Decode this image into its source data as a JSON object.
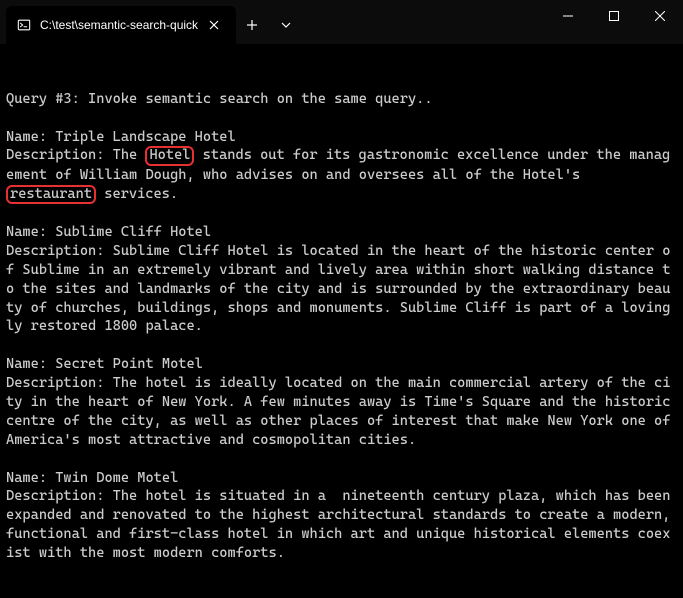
{
  "titlebar": {
    "tab_title": "C:\\test\\semantic-search-quick",
    "new_tab_tooltip": "New Tab",
    "dropdown_tooltip": "Tab options"
  },
  "terminal": {
    "blank_line": "",
    "query_header": "Query #3: Invoke semantic search on the same query..",
    "results": [
      {
        "name_label": "Name: ",
        "name": "Triple Landscape Hotel",
        "desc_label": "Description: ",
        "desc_part1": "The ",
        "highlight1": "Hotel",
        "desc_part2": " stands out for its gastronomic excellence under the management of William Dough, who advises on and oversees all of the Hotel's ",
        "highlight2": "restaurant",
        "desc_part3": " services."
      },
      {
        "name_label": "Name: ",
        "name": "Sublime Cliff Hotel",
        "desc_label": "Description: ",
        "desc": "Sublime Cliff Hotel is located in the heart of the historic center of Sublime in an extremely vibrant and lively area within short walking distance to the sites and landmarks of the city and is surrounded by the extraordinary beauty of churches, buildings, shops and monuments. Sublime Cliff is part of a lovingly restored 1800 palace."
      },
      {
        "name_label": "Name: ",
        "name": "Secret Point Motel",
        "desc_label": "Description: ",
        "desc": "The hotel is ideally located on the main commercial artery of the city in the heart of New York. A few minutes away is Time's Square and the historic centre of the city, as well as other places of interest that make New York one of America's most attractive and cosmopolitan cities."
      },
      {
        "name_label": "Name: ",
        "name": "Twin Dome Motel",
        "desc_label": "Description: ",
        "desc": "The hotel is situated in a  nineteenth century plaza, which has been expanded and renovated to the highest architectural standards to create a modern, functional and first-class hotel in which art and unique historical elements coexist with the most modern comforts."
      }
    ]
  }
}
